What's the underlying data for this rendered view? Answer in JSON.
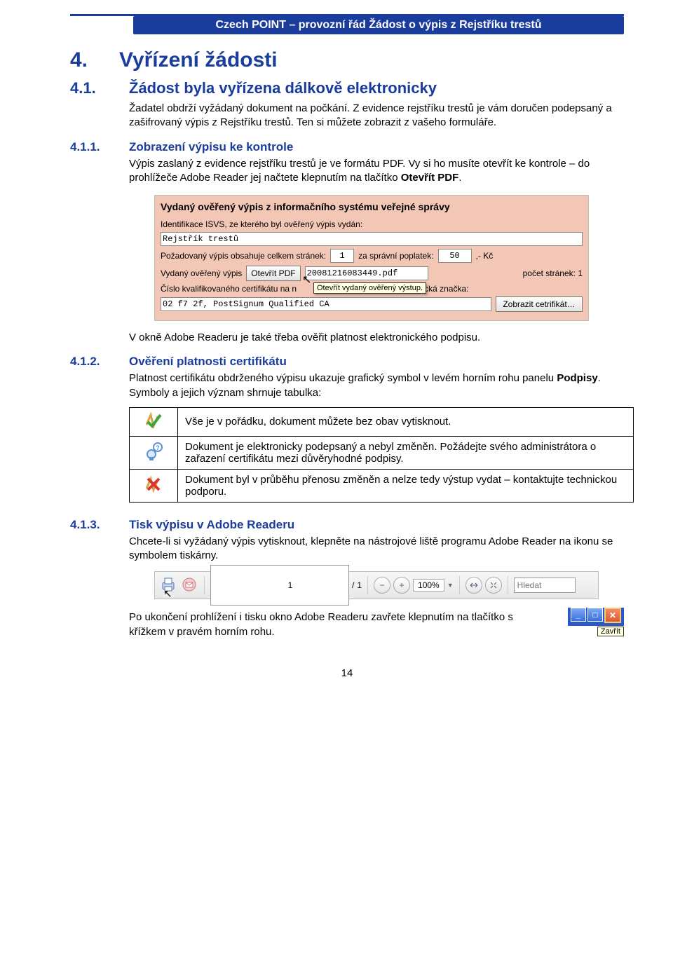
{
  "header": {
    "title": "Czech POINT – provozní řád Žádost o výpis z Rejstříku trestů"
  },
  "sections": {
    "s4": {
      "num": "4.",
      "title": "Vyřízení žádosti"
    },
    "s41": {
      "num": "4.1.",
      "title": "Žádost byla vyřízena dálkově elektronicky",
      "p1": "Žadatel obdrží vyžádaný dokument na počkání. Z evidence rejstříku trestů je vám doručen podepsaný a zašifrovaný výpis z Rejstříku trestů. Ten si můžete zobrazit z vašeho formuláře."
    },
    "s411": {
      "num": "4.1.1.",
      "title": "Zobrazení výpisu ke kontrole",
      "p1_a": "Výpis zaslaný z evidence rejstříku trestů je ve formátu PDF. Vy si ho musíte otevřít ke kontrole – do prohlížeče Adobe Reader jej načtete klepnutím na tlačítko ",
      "p1_b": "Otevřít PDF",
      "p1_c": ".",
      "p2": "V okně Adobe Readeru je také třeba ověřit platnost elektronického podpisu."
    },
    "s412": {
      "num": "4.1.2.",
      "title": "Ověření platnosti certifikátu",
      "p1_a": "Platnost certifikátu obdrženého výpisu ukazuje grafický symbol v levém horním rohu panelu ",
      "p1_b": "Podpisy",
      "p1_c": ". Symboly a jejich význam shrnuje tabulka:",
      "table": {
        "r1": "Vše je v pořádku, dokument můžete bez obav vytisknout.",
        "r2": "Dokument je elektronicky podepsaný a nebyl změněn. Požádejte svého administrátora o zařazení certifikátu mezi důvěryhodné podpisy.",
        "r3": "Dokument byl v průběhu přenosu změněn a nelze tedy výstup vydat – kontaktujte technickou podporu."
      }
    },
    "s413": {
      "num": "4.1.3.",
      "title": "Tisk výpisu v Adobe Readeru",
      "p1": "Chcete-li si vyžádaný výpis vytisknout, klepněte na nástrojové liště programu Adobe Reader na ikonu se symbolem tiskárny.",
      "p2": "Po ukončení prohlížení i tisku okno Adobe Readeru zavřete klepnutím na tlačítko s křížkem v pravém horním rohu.",
      "close_tooltip": "Zavřít"
    }
  },
  "form": {
    "title": "Vydaný ověřený výpis z informačního systému veřejné správy",
    "l_ident": "Identifikace ISVS, ze kterého byl ověřený výpis vydán:",
    "v_ident": "Rejstřík trestů",
    "l_pages_a": "Požadovaný výpis obsahuje celkem stránek:",
    "v_pages": "1",
    "l_pages_b": "za správní poplatek:",
    "v_fee": "50",
    "l_fee_suffix": ",- Kč",
    "l_issued": "Vydaný ověřený výpis",
    "btn_open": "Otevřít PDF",
    "v_filename": "20081216083449.pdf",
    "l_pagecount": "počet stránek: 1",
    "l_cert": "Číslo kvalifikovaného certifikátu na n",
    "tooltip": "Otevřít vydaný ověřený výstup.",
    "l_cert_suffix": "onická značka:",
    "v_cert": "02 f7 2f, PostSignum Qualified CA",
    "btn_showcert": "Zobrazit cetrifikát…"
  },
  "toolbar": {
    "page_current": "1",
    "page_sep": "/",
    "page_total": "1",
    "zoom": "100%",
    "search_placeholder": "Hledat"
  },
  "page_number": "14"
}
